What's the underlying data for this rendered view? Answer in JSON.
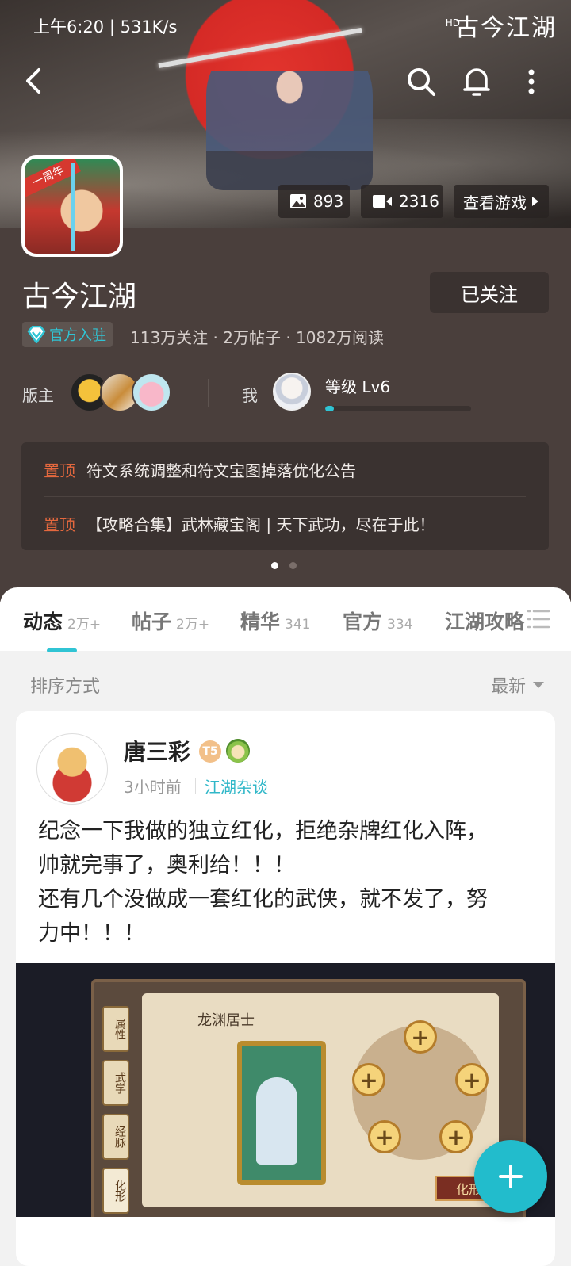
{
  "status_bar": {
    "time_speed": "上午6:20 | 531K/s",
    "hd": "HD",
    "logo_text": "古今江湖"
  },
  "header": {
    "back_icon": "back-arrow-icon",
    "search_icon": "search-icon",
    "bell_icon": "bell-icon",
    "more_icon": "more-icon"
  },
  "media": {
    "images_count": "893",
    "videos_count": "2316",
    "view_game_label": "查看游戏"
  },
  "app_icon": {
    "badge_text": "一周年"
  },
  "forum": {
    "title": "古今江湖",
    "follow_label": "已关注",
    "official_badge": "官方入驻",
    "stats": "113万关注 · 2万帖子 · 1082万阅读",
    "moderator_label": "版主",
    "me_label": "我",
    "level_label": "等级 Lv6",
    "level_progress": 0.06
  },
  "pinned": [
    {
      "tag": "置顶",
      "text": "符文系统调整和符文宝图掉落优化公告"
    },
    {
      "tag": "置顶",
      "text": "【攻略合集】武林藏宝阁 | 天下武功，尽在于此！"
    }
  ],
  "tabs": [
    {
      "label": "动态",
      "count": "2万+"
    },
    {
      "label": "帖子",
      "count": "2万+"
    },
    {
      "label": "精华",
      "count": "341"
    },
    {
      "label": "官方",
      "count": "334"
    },
    {
      "label": "江湖攻略",
      "count": ""
    }
  ],
  "sort": {
    "label": "排序方式",
    "value": "最新"
  },
  "post": {
    "author": "唐三彩",
    "level_badge": "T5",
    "time": "3小时前",
    "category": "江湖杂谈",
    "body_lines": [
      "纪念一下我做的独立红化，拒绝杂牌红化入阵，",
      "帅就完事了，奥利给！！！",
      "还有几个没做成一套红化的武侠，就不发了，努",
      "力中！！！"
    ],
    "image": {
      "title": "龙渊居士",
      "side_tabs": [
        "属性",
        "武学",
        "经脉",
        "化形"
      ],
      "button": "化形"
    }
  },
  "colors": {
    "accent": "#30c4d4",
    "pin_tag": "#e4683e",
    "header_bg": "#4a3f3c"
  }
}
